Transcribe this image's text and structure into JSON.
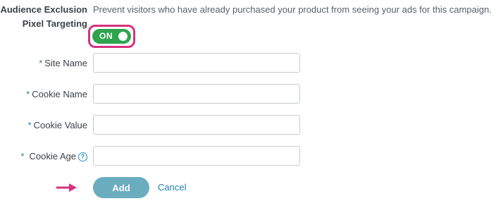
{
  "section": {
    "label_line1": "Audience Exclusion",
    "label_line2": "Pixel Targeting",
    "description": "Prevent visitors who have already purchased your product from seeing your ads for this campaign."
  },
  "toggle": {
    "state_label": "ON",
    "is_on": true
  },
  "fields": {
    "required_marker": "*",
    "site_name": {
      "label": "Site Name",
      "value": ""
    },
    "cookie_name": {
      "label": "Cookie Name",
      "value": ""
    },
    "cookie_value": {
      "label": "Cookie Value",
      "value": ""
    },
    "cookie_age": {
      "label": "Cookie Age",
      "value": "",
      "help_glyph": "?"
    }
  },
  "actions": {
    "add_label": "Add",
    "cancel_label": "Cancel"
  },
  "colors": {
    "toggle_on": "#2ea44f",
    "highlight": "#d6317f",
    "add_button": "#6aadbf",
    "link": "#1f7fa6",
    "required": "#2a7fa8"
  },
  "icons": {
    "help": "question-circle-icon",
    "pointer": "arrow-right-icon"
  }
}
